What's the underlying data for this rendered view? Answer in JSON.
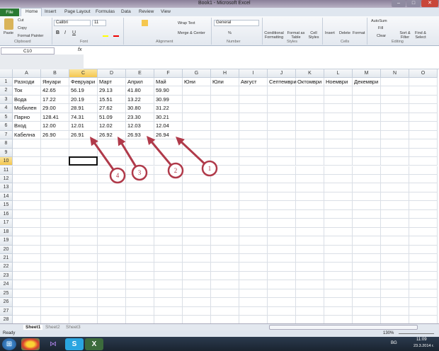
{
  "window": {
    "title": "Book1 - Microsoft Excel"
  },
  "tabs": [
    "File",
    "Home",
    "Insert",
    "Page Layout",
    "Formulas",
    "Data",
    "Review",
    "View"
  ],
  "ribbon": {
    "clipboard": {
      "paste": "Paste",
      "cut": "Cut",
      "copy": "Copy",
      "format_painter": "Format Painter",
      "group": "Clipboard"
    },
    "font": {
      "name": "Calibri",
      "size": "11",
      "group": "Font",
      "bold": "B",
      "italic": "I",
      "underline": "U"
    },
    "alignment": {
      "wrap": "Wrap Text",
      "merge": "Merge & Center",
      "group": "Alignment"
    },
    "number": {
      "format": "General",
      "percent": "%",
      "group": "Number"
    },
    "styles": {
      "conditional": "Conditional Formatting",
      "format_table": "Format as Table",
      "cell_styles": "Cell Styles",
      "group": "Styles"
    },
    "cells": {
      "insert": "Insert",
      "delete": "Delete",
      "format": "Format",
      "group": "Cells"
    },
    "editing": {
      "autosum": "AutoSum",
      "fill": "Fill",
      "clear": "Clear",
      "sort": "Sort & Filter",
      "find": "Find & Select",
      "group": "Editing"
    }
  },
  "formula_bar": {
    "name_box": "C10",
    "fx": "fx",
    "value": ""
  },
  "columns": [
    "A",
    "B",
    "C",
    "D",
    "E",
    "F",
    "G",
    "H",
    "I",
    "J",
    "K",
    "L",
    "M",
    "N",
    "O"
  ],
  "selected_cell": {
    "col": "C",
    "row": 10
  },
  "rows": [
    [
      "Разходи",
      "Януари",
      "Февруари",
      "Март",
      "Април",
      "Май",
      "Юни",
      "Юли",
      "Август",
      "Септември",
      "Октомври",
      "Ноември",
      "Декември"
    ],
    [
      "Ток",
      "42.65",
      "56.19",
      "29.13",
      "41.80",
      "59.90"
    ],
    [
      "Вода",
      "17.22",
      "20.19",
      "15.51",
      "13.22",
      "30.99"
    ],
    [
      "Мобилен",
      "29.00",
      "28.91",
      "27.62",
      "30.80",
      "31.22"
    ],
    [
      "Парно",
      "128.41",
      "74.31",
      "51.09",
      "23.30",
      "30.21"
    ],
    [
      "Вход",
      "12.00",
      "12.01",
      "12.02",
      "12.03",
      "12.04"
    ],
    [
      "Кабелна",
      "26.90",
      "26.91",
      "26.92",
      "26.93",
      "26.94"
    ]
  ],
  "row_count": 28,
  "annotations": [
    "4",
    "3",
    "2",
    "1"
  ],
  "sheets": [
    "Sheet1",
    "Sheet2",
    "Sheet3"
  ],
  "status": {
    "ready": "Ready",
    "zoom": "130%"
  },
  "taskbar": {
    "lang": "BG",
    "time": "11:09",
    "date": "23.3.2014 г."
  },
  "colors": {
    "accent": "#b03a4a",
    "file_tab": "#2a7a32",
    "selected_header": "#f5c74f"
  }
}
